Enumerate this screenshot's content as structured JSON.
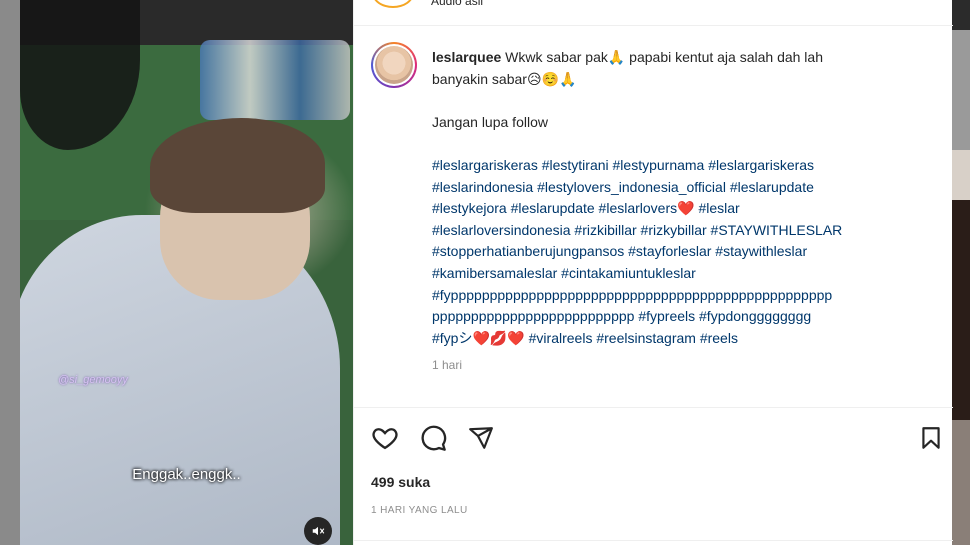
{
  "header": {
    "audio_label": "Audio asli"
  },
  "caption": {
    "username": "leslarquee",
    "text_line1": "Wkwk sabar pak🙏 papabi kentut aja salah dah lah",
    "text_line2": "banyakin sabar😥☺️🙏",
    "text_line3": "Jangan lupa follow",
    "hashtags": [
      "#leslargariskeras #lestytirani #lestypurnama #leslargariskeras",
      "#leslarindonesia #lestylovers_indonesia_official #leslarupdate",
      "#lestykejora #leslarupdate #leslarlovers❤️ #leslar",
      "#leslarloversindonesia #rizkibillar #rizkybillar #STAYWITHLESLAR",
      "#stopperhatianberujungpansos #stayforleslar #staywithleslar",
      "#kamibersamaleslar #cintakamiuntukleslar",
      "#fyppppppppppppppppppppppppppppppppppppppppppppppppp",
      "pppppppppppppppppppppppppp #fypreels #fypdongggggggg",
      "#fypシ❤️💋❤️ #viralreels #reelsinstagram #reels"
    ],
    "timestamp": "1 hari"
  },
  "video": {
    "watermark": "@si_gemooyy",
    "subtitle": "Enggak..enggk.."
  },
  "actions": {
    "likes": "499 suka",
    "posted": "1 HARI YANG LALU"
  },
  "colors": {
    "hashtag": "#00376b",
    "text": "#262626",
    "muted": "#8e8e8e"
  }
}
